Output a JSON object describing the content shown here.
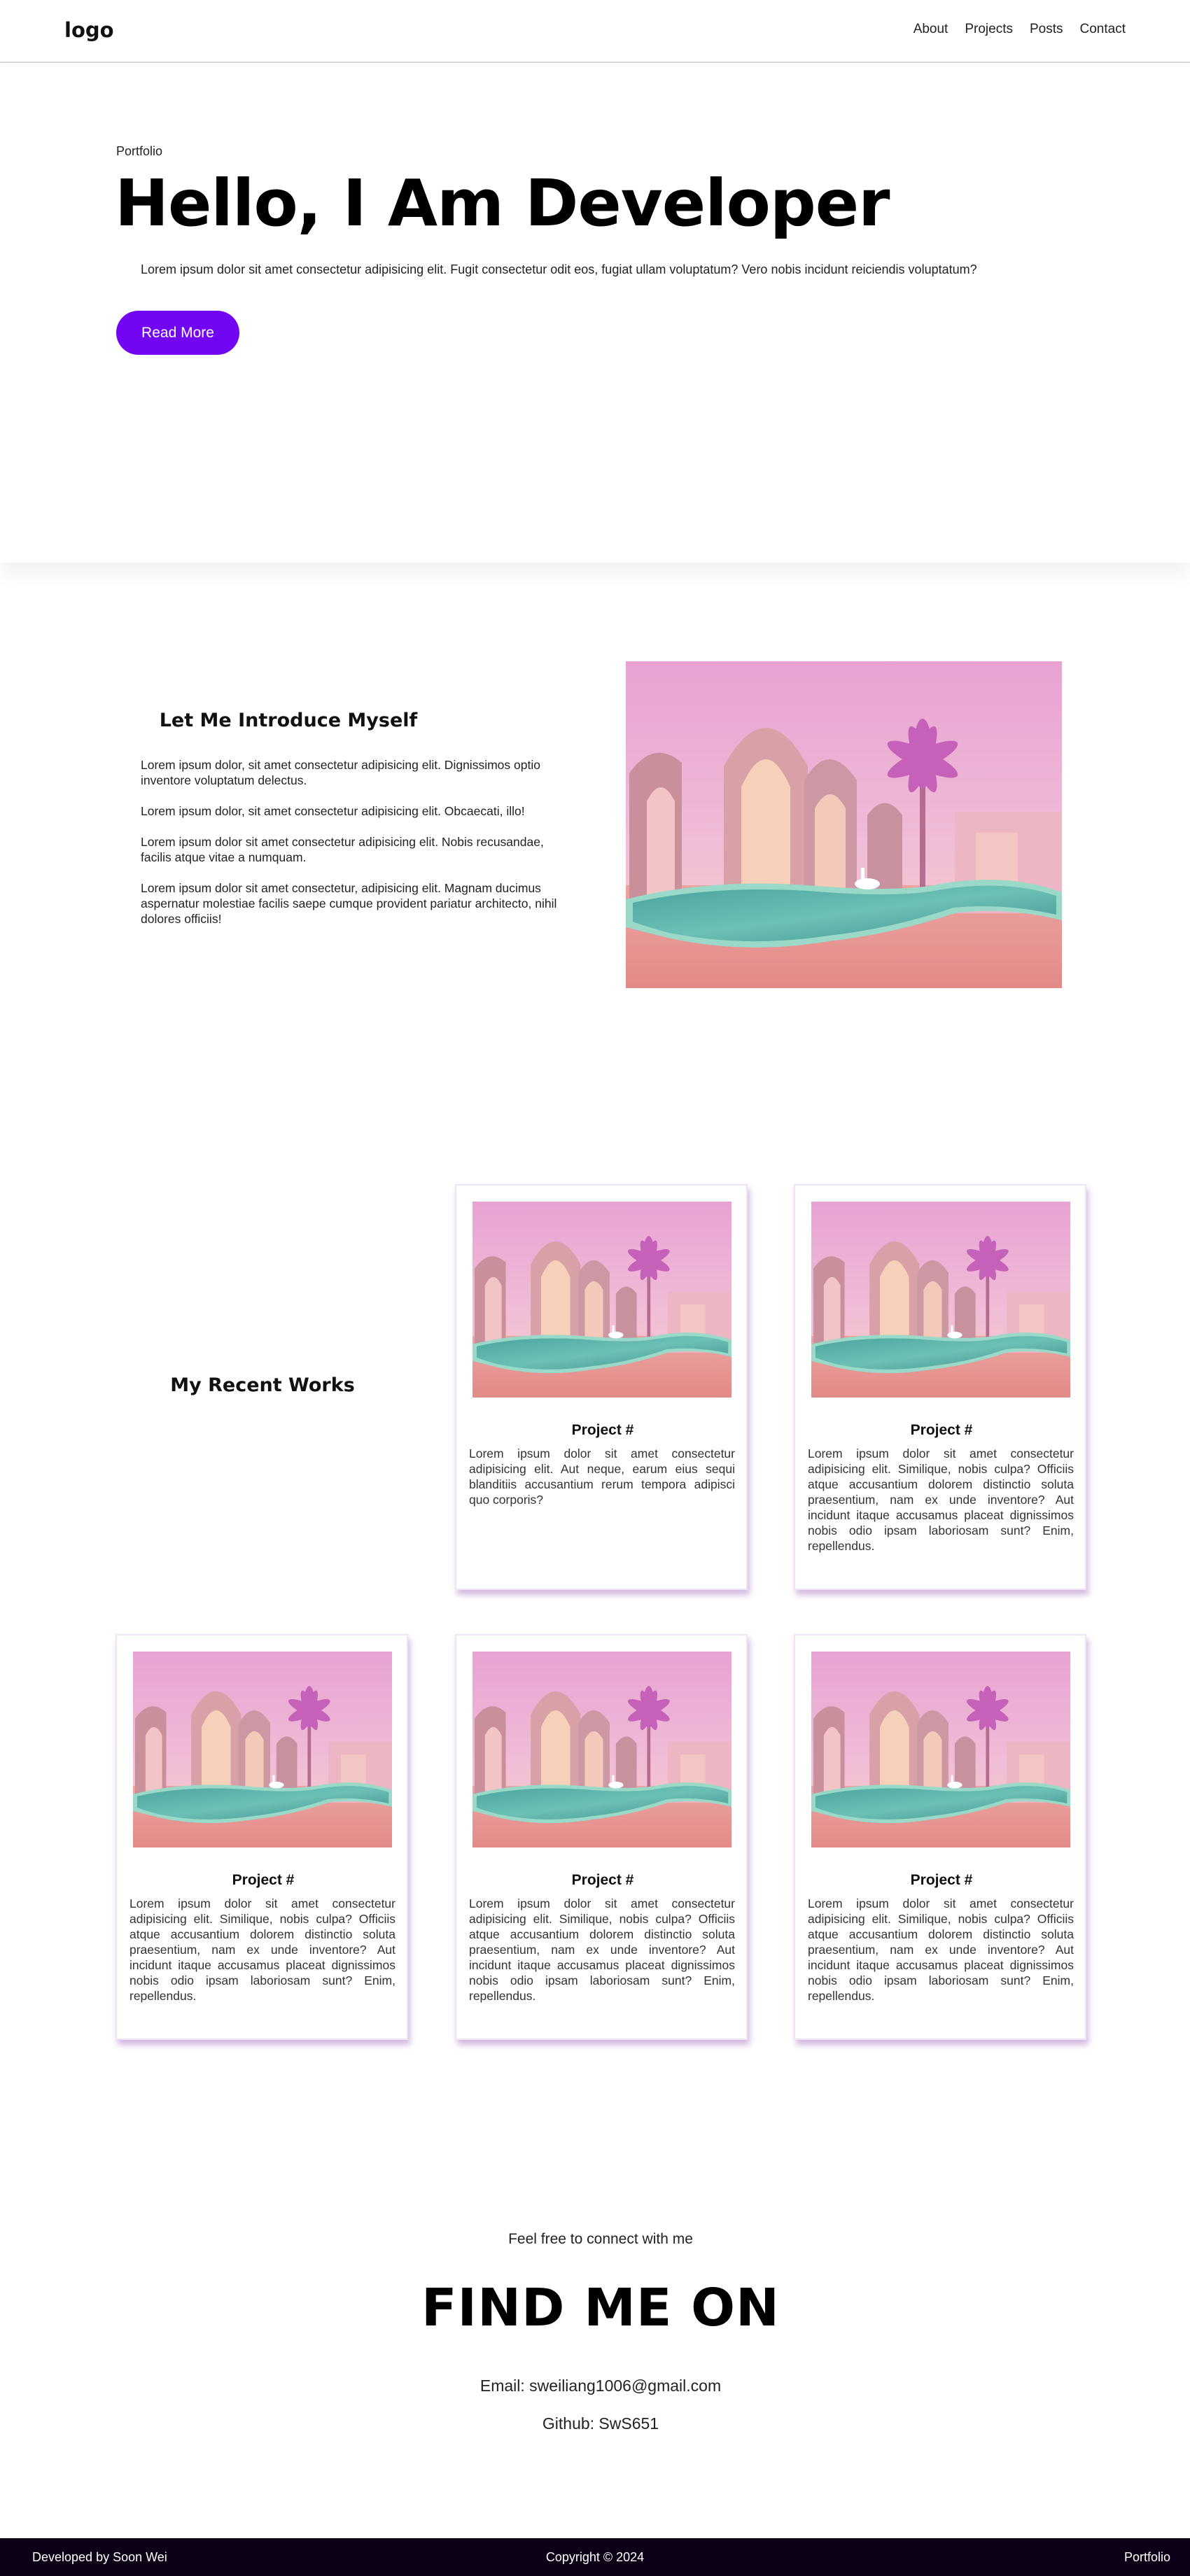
{
  "nav": {
    "logo": "logo",
    "links": [
      "About",
      "Projects",
      "Posts",
      "Contact"
    ]
  },
  "hero": {
    "kicker": "Portfolio",
    "title": "Hello, I Am Developer",
    "description": "Lorem ipsum dolor sit amet consectetur adipisicing elit. Fugit consectetur odit eos, fugiat ullam voluptatum? Vero nobis incidunt reiciendis voluptatum?",
    "button_label": "Read More",
    "accent_color": "#7206f2"
  },
  "about": {
    "title": "Let Me Introduce Myself",
    "paragraphs": [
      "Lorem ipsum dolor, sit amet consectetur adipisicing elit. Dignissimos optio inventore voluptatum delectus.",
      "Lorem ipsum dolor, sit amet consectetur adipisicing elit. Obcaecati, illo!",
      "Lorem ipsum dolor sit amet consectetur adipisicing elit. Nobis recusandae, facilis atque vitae a numquam.",
      "Lorem ipsum dolor sit amet consectetur, adipisicing elit. Magnam ducimus aspernatur molestiae facilis saepe cumque provident pariatur architecto, nihil dolores officiis!"
    ],
    "image_icon": "pink-pool-arches-image"
  },
  "works": {
    "title": "My Recent Works",
    "projects": [
      {
        "title": "Project #",
        "text": "Lorem ipsum dolor sit amet consectetur adipisicing elit. Aut neque, earum eius sequi blanditiis accusantium rerum tempora adipisci quo corporis?"
      },
      {
        "title": "Project #",
        "text": "Lorem ipsum dolor sit amet consectetur adipisicing elit. Similique, nobis culpa? Officiis atque accusantium dolorem distinctio soluta praesentium, nam ex unde inventore? Aut incidunt itaque accusamus placeat dignissimos nobis odio ipsam laboriosam sunt? Enim, repellendus."
      },
      {
        "title": "Project #",
        "text": "Lorem ipsum dolor sit amet consectetur adipisicing elit. Similique, nobis culpa? Officiis atque accusantium dolorem distinctio soluta praesentium, nam ex unde inventore? Aut incidunt itaque accusamus placeat dignissimos nobis odio ipsam laboriosam sunt? Enim, repellendus."
      },
      {
        "title": "Project #",
        "text": "Lorem ipsum dolor sit amet consectetur adipisicing elit. Similique, nobis culpa? Officiis atque accusantium dolorem distinctio soluta praesentium, nam ex unde inventore? Aut incidunt itaque accusamus placeat dignissimos nobis odio ipsam laboriosam sunt? Enim, repellendus."
      },
      {
        "title": "Project #",
        "text": "Lorem ipsum dolor sit amet consectetur adipisicing elit. Similique, nobis culpa? Officiis atque accusantium dolorem distinctio soluta praesentium, nam ex unde inventore? Aut incidunt itaque accusamus placeat dignissimos nobis odio ipsam laboriosam sunt? Enim, repellendus."
      }
    ]
  },
  "contact": {
    "intro": "Feel free to connect with me",
    "title": "FIND ME ON",
    "email": "Email: sweiliang1006@gmail.com",
    "github": "Github: SwS651"
  },
  "footer": {
    "left": "Developed by Soon Wei",
    "center": "Copyright © 2024",
    "right": "Portfolio"
  }
}
